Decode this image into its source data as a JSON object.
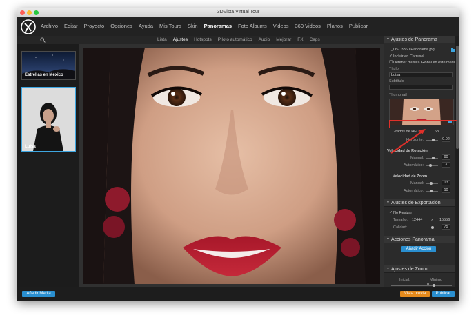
{
  "window": {
    "title": "3DVista Virtual Tour"
  },
  "menu": {
    "items": [
      "Archivo",
      "Editar",
      "Proyecto",
      "Opciones",
      "Ayuda",
      "Mis Tours",
      "Skin",
      "Panoramas",
      "Foto Albums",
      "Videos",
      "360 Videos",
      "Planos",
      "Publicar"
    ],
    "active": "Panoramas"
  },
  "subtabs": {
    "items": [
      "Lista",
      "Ajustes",
      "Hotspots",
      "Piloto automático",
      "Audio",
      "Mejorar",
      "FX",
      "Caps"
    ],
    "active": "Ajustes"
  },
  "panoramas": [
    {
      "label": "Estrellas en México",
      "selected": false
    },
    {
      "label": "Luisa",
      "selected": true
    }
  ],
  "panel": {
    "ajustes_title": "Ajustes de Panorama",
    "filename": "_DSC3360 Panorama.jpg",
    "incluir_carrusel": "Incluir en Carrusel",
    "detener_musica": "Detener música Global en este medio",
    "titulo_label": "Título",
    "titulo_value": "Luisa",
    "subtitulo_label": "Subtítulo",
    "thumbnail_label": "Thumbnail",
    "hfov_label": "Grados de HFOV:",
    "hfov_value": "63",
    "horizonte_label": "Horizonte:",
    "horizonte_value": "0.02",
    "velocidad_rotacion": "Velocidad de Rotación",
    "manual_label": "Manual:",
    "rot_manual": "90",
    "automatico_label": "Automático:",
    "rot_auto": "3",
    "velocidad_zoom": "Velocidad de Zoom",
    "zoom_manual": "13",
    "zoom_auto": "10",
    "export_title": "Ajustes de Exportación",
    "no_resizar": "No Resizar",
    "tamano_label": "Tamaño:",
    "tamano_w": "12444",
    "tamano_x": "x",
    "tamano_h": "15556",
    "calidad_label": "Calidad:",
    "calidad_value": "75",
    "acciones_title": "Acciones Panorama",
    "anadir_accion": "Añadir Acción",
    "zoom_title": "Ajustes de Zoom",
    "inicial_label": "Inicial:",
    "minimo_label": "Mínimo",
    "zoom_value": "0"
  },
  "bottom": {
    "add_media": "Añadir Media",
    "preview": "Vista previa",
    "publish": "Publicar"
  },
  "colors": {
    "accent": "#2a8fd0",
    "preview": "#e58a1c",
    "highlight": "#e0302a"
  }
}
